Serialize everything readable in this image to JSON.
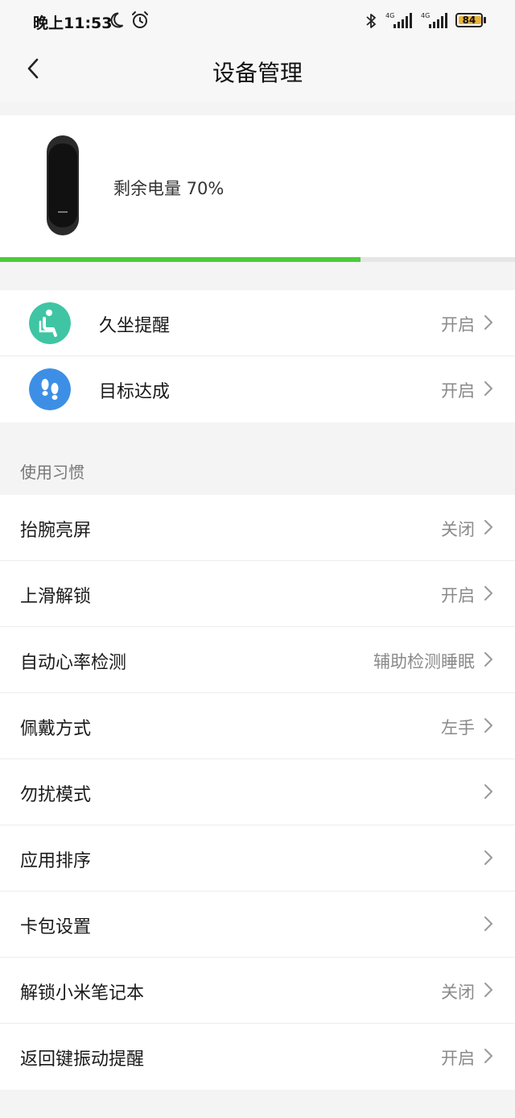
{
  "status_bar": {
    "time": "晚上11:53",
    "battery": "84",
    "icons": [
      "moon-icon",
      "alarm-icon",
      "bluetooth-icon",
      "signal-4g-icon",
      "signal-4g-icon",
      "battery-icon"
    ]
  },
  "nav": {
    "title": "设备管理",
    "back_icon": "chevron-left-icon"
  },
  "device": {
    "battery_text": "剩余电量 70%",
    "battery_level": 0.7,
    "accent_color": "#4ccc3a"
  },
  "reminders": [
    {
      "label": "久坐提醒",
      "value": "开启",
      "icon": "sedentary-icon",
      "icon_color": "#3fc5a4"
    },
    {
      "label": "目标达成",
      "value": "开启",
      "icon": "footprints-icon",
      "icon_color": "#3d8fe6"
    }
  ],
  "habits": {
    "header": "使用习惯",
    "items": [
      {
        "label": "抬腕亮屏",
        "value": "关闭"
      },
      {
        "label": "上滑解锁",
        "value": "开启"
      },
      {
        "label": "自动心率检测",
        "value": "辅助检测睡眠"
      },
      {
        "label": "佩戴方式",
        "value": "左手"
      },
      {
        "label": "勿扰模式",
        "value": ""
      },
      {
        "label": "应用排序",
        "value": ""
      },
      {
        "label": "卡包设置",
        "value": ""
      },
      {
        "label": "解锁小米笔记本",
        "value": "关闭"
      },
      {
        "label": "返回键振动提醒",
        "value": "开启"
      }
    ]
  }
}
